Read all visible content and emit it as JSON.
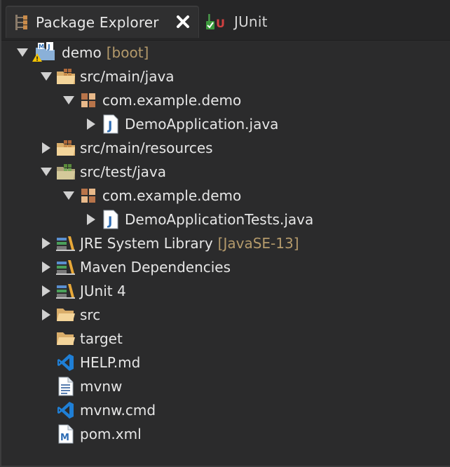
{
  "tabs": {
    "active_label": "Package Explorer",
    "inactive_label": "JUnit"
  },
  "tree": {
    "project": {
      "label": "demo",
      "decoration": "[boot]"
    },
    "src_main_java": {
      "label": "src/main/java"
    },
    "pkg_main": {
      "label": "com.example.demo"
    },
    "demo_app": {
      "label": "DemoApplication.java"
    },
    "src_main_resources": {
      "label": "src/main/resources"
    },
    "src_test_java": {
      "label": "src/test/java"
    },
    "pkg_test": {
      "label": "com.example.demo"
    },
    "demo_app_tests": {
      "label": "DemoApplicationTests.java"
    },
    "jre": {
      "label": "JRE System Library",
      "decoration": "[JavaSE-13]"
    },
    "maven": {
      "label": "Maven Dependencies"
    },
    "junit4": {
      "label": "JUnit 4"
    },
    "src": {
      "label": "src"
    },
    "target": {
      "label": "target"
    },
    "help": {
      "label": "HELP.md"
    },
    "mvnw": {
      "label": "mvnw"
    },
    "mvnw_cmd": {
      "label": "mvnw.cmd"
    },
    "pom": {
      "label": "pom.xml"
    }
  },
  "colors": {
    "background": "#2b2b2c",
    "text": "#e6e6e6",
    "decoration": "#b49a6b",
    "folder": "#e8c58a",
    "java_icon": "#2e6db4",
    "vscode_icon": "#1f7fd6"
  },
  "icons": {
    "tab_active": "hierarchy-icon",
    "tab_close": "close-icon",
    "tab_junit": "junit-icon",
    "project": "maven-java-project-icon",
    "source_folder": "package-folder-icon",
    "package": "package-icon",
    "java_file": "java-file-icon",
    "library": "library-icon",
    "folder": "folder-icon",
    "vscode_file": "vscode-file-icon",
    "text_file": "text-file-icon",
    "maven_file": "maven-file-icon"
  }
}
